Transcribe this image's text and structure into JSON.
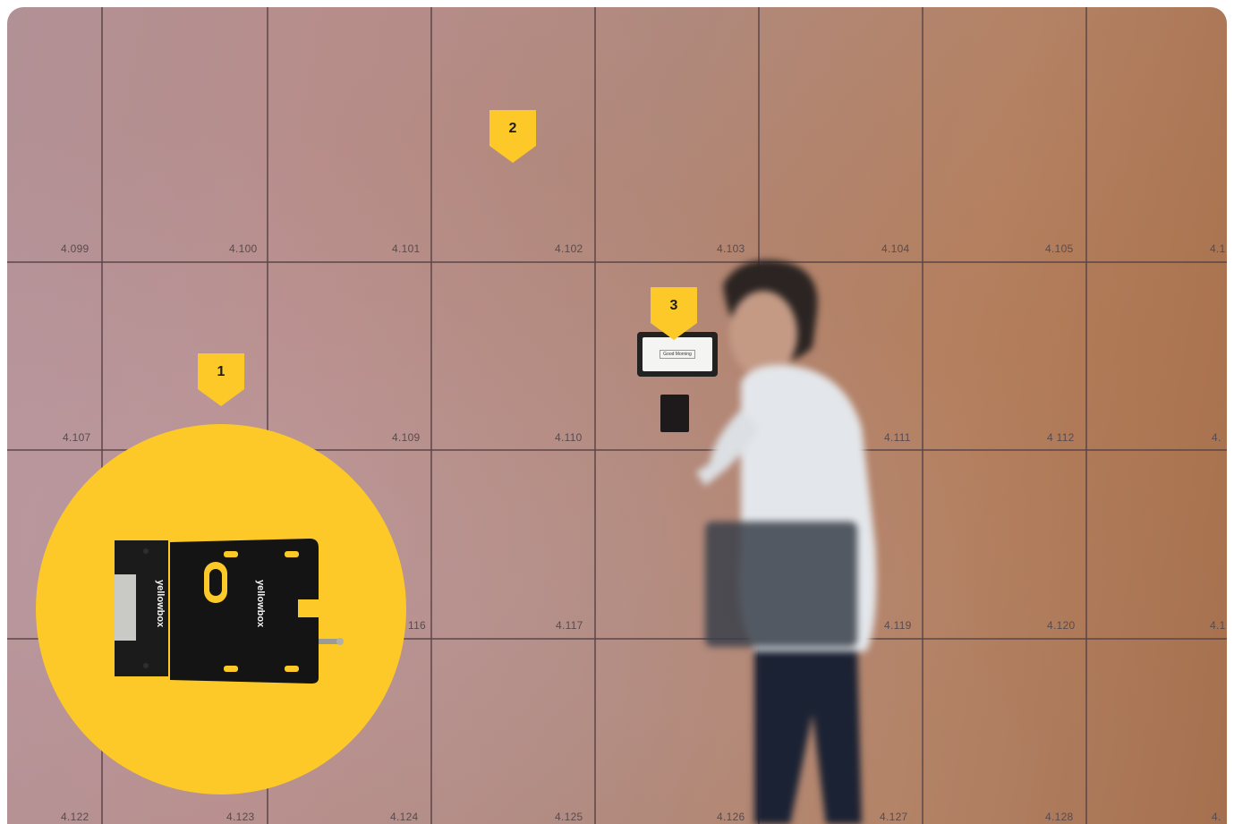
{
  "lockers": {
    "row1": [
      "4.099",
      "4.100",
      "4.101",
      "4.102",
      "4.103",
      "4.104",
      "4.105",
      "4.1"
    ],
    "row2": [
      "4.107",
      "4.109",
      "4.110",
      "4.111",
      "4 112",
      "4."
    ],
    "row3": [
      "116",
      "4.117",
      "4.119",
      "4.120",
      "4.1"
    ],
    "row4": [
      "4.122",
      "4.123",
      "4.124",
      "4.125",
      "4.126",
      "4.127",
      "4.128",
      "4."
    ]
  },
  "callouts": {
    "one": "1",
    "two": "2",
    "three": "3"
  },
  "screen_text": "Good Morning",
  "brand": "yellowbox",
  "colors": {
    "accent": "#fcc928",
    "wall": "#b08a7f",
    "lock": "#1b1b1b"
  }
}
